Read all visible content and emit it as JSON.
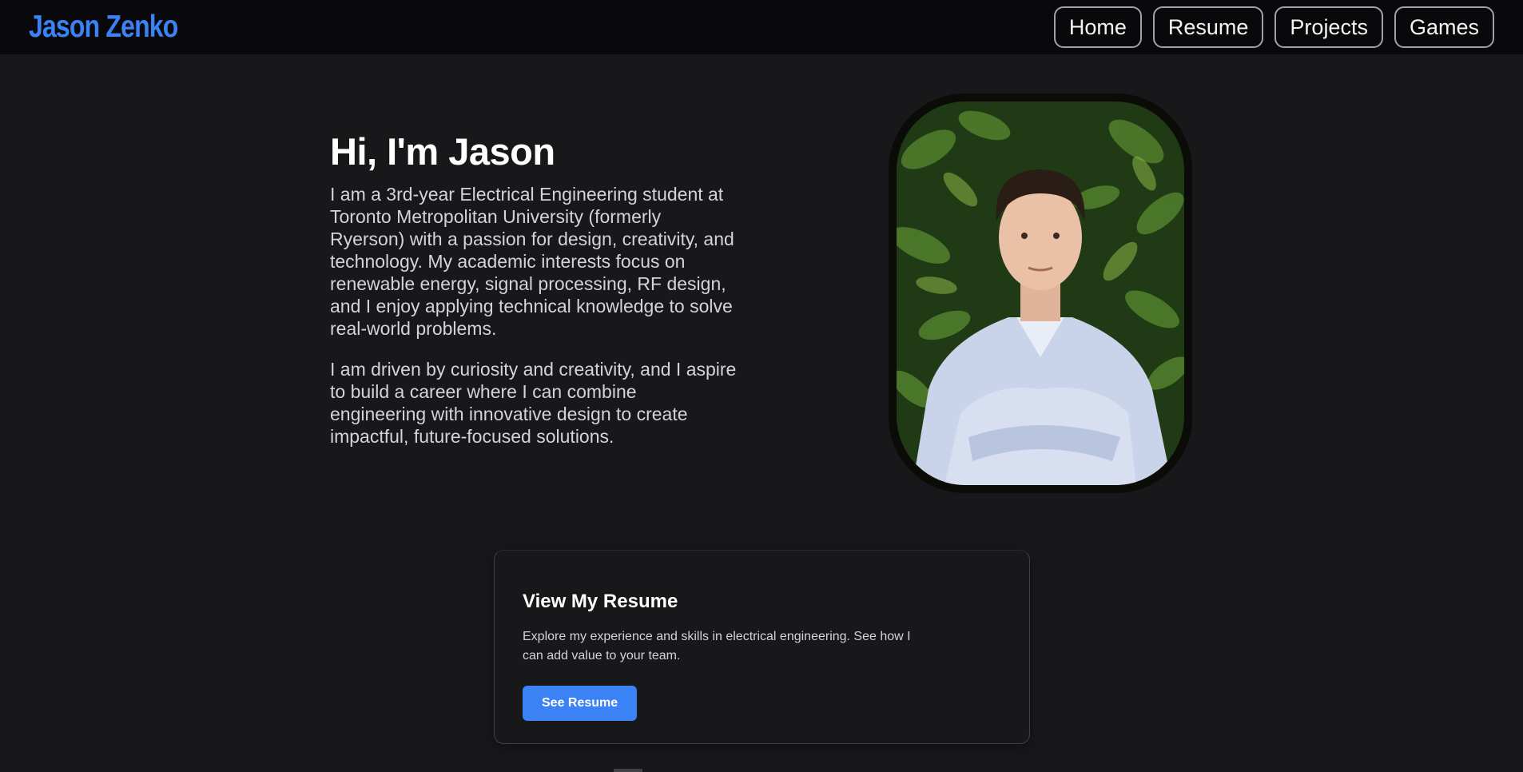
{
  "header": {
    "brand": "Jason Zenko",
    "nav": [
      "Home",
      "Resume",
      "Projects",
      "Games"
    ]
  },
  "hero": {
    "title": "Hi, I'm Jason",
    "paragraphs": [
      "I am a 3rd-year Electrical Engineering student at Toronto Metropolitan University (formerly Ryerson) with a passion for design, creativity, and technology. My academic interests focus on renewable energy, signal processing, RF design, and I enjoy applying technical knowledge to solve real-world problems.",
      "I am driven by curiosity and creativity, and I aspire to build a career where I can combine engineering with innovative design to create impactful, future-focused solutions."
    ]
  },
  "resume_card": {
    "title": "View My Resume",
    "description": "Explore my experience and skills in electrical engineering. See how I can add value to your team.",
    "button": "See Resume"
  },
  "colors": {
    "accent": "#3b82f6",
    "background": "#18181b",
    "navbar": "#09090b"
  }
}
